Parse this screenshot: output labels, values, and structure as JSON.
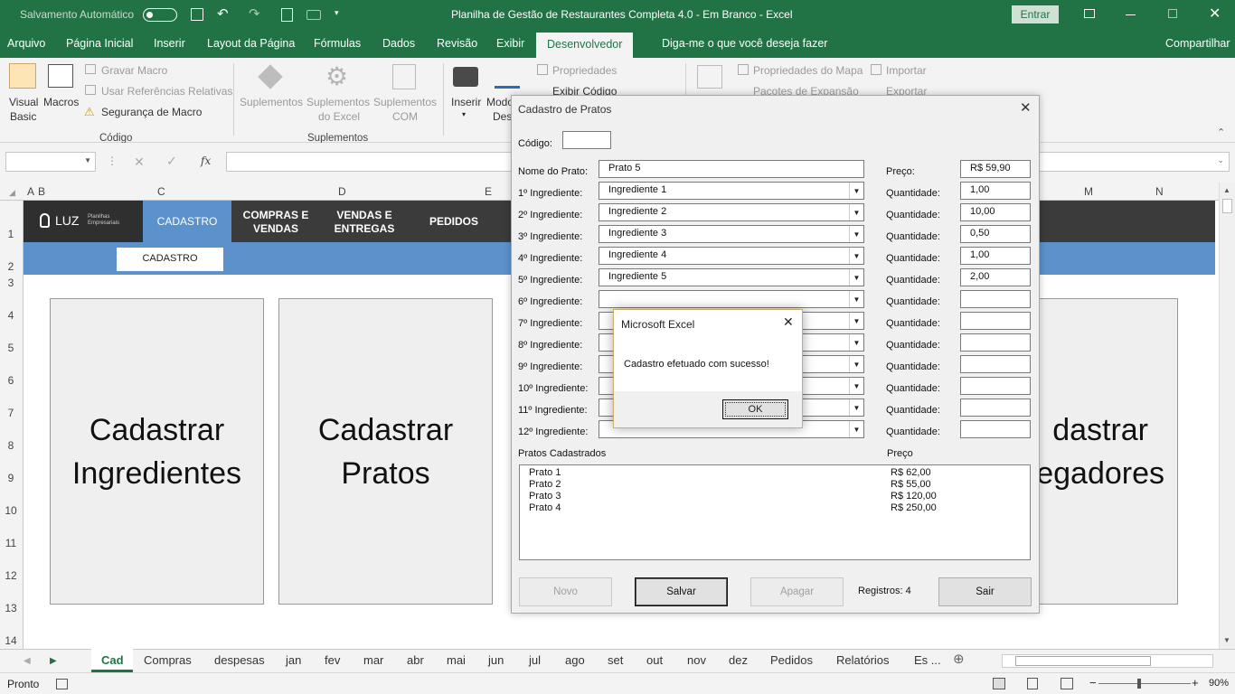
{
  "window": {
    "autosave_label": "Salvamento Automático",
    "title": "Planilha de Gestão de Restaurantes Completa 4.0 - Em Branco  -  Excel",
    "signin": "Entrar"
  },
  "ribbon_tabs": [
    "Arquivo",
    "Página Inicial",
    "Inserir",
    "Layout da Página",
    "Fórmulas",
    "Dados",
    "Revisão",
    "Exibir",
    "Desenvolvedor"
  ],
  "tell_me": "Diga-me o que você deseja fazer",
  "share": "Compartilhar",
  "ribbon": {
    "visual_basic": [
      "Visual",
      "Basic"
    ],
    "macros": "Macros",
    "record_macro": "Gravar Macro",
    "relative_refs": "Usar Referências Relativas",
    "macro_security": "Segurança de Macro",
    "group_code": "Código",
    "addins": "Suplementos",
    "excel_addins": [
      "Suplementos",
      "do Excel"
    ],
    "com_addins": [
      "Suplementos",
      "COM"
    ],
    "group_addins": "Suplementos",
    "insert": "Inserir",
    "design_mode": [
      "Modo",
      "Desi"
    ],
    "properties": "Propriedades",
    "view_code": "Exibir Código",
    "map_properties": "Propriedades do Mapa",
    "expansion_packs": "Pacotes de Expansão",
    "import": "Importar",
    "export": "Exportar"
  },
  "formula": {
    "fx": "fx",
    "name_box": ""
  },
  "columns": [
    "A",
    "B",
    "C",
    "D",
    "E",
    "M",
    "N"
  ],
  "rows": [
    "1",
    "2",
    "3",
    "4",
    "5",
    "6",
    "7",
    "8",
    "9",
    "10",
    "11",
    "12",
    "13",
    "14"
  ],
  "sheet": {
    "logo": "LUZ",
    "logo_sub": [
      "Planilhas",
      "Empresariais"
    ],
    "nav": [
      "CADASTRO",
      "COMPRAS E VENDAS",
      "VENDAS E ENTREGAS",
      "PEDIDOS"
    ],
    "sub_tab": "CADASTRO",
    "cards": [
      "Cadastrar Ingredientes",
      "Cadastrar Pratos",
      "dastrar egadores"
    ]
  },
  "form": {
    "title": "Cadastro de Pratos",
    "code_label": "Código:",
    "code_value": "",
    "name_label": "Nome do Prato:",
    "name_value": "Prato 5",
    "price_label": "Preço:",
    "price_value": "R$ 59,90",
    "qty_label": "Quantidade:",
    "ingredients": [
      {
        "label": "1º Ingrediente:",
        "value": "Ingrediente 1",
        "qty": "1,00"
      },
      {
        "label": "2º Ingrediente:",
        "value": "Ingrediente 2",
        "qty": "10,00"
      },
      {
        "label": "3º Ingrediente:",
        "value": "Ingrediente 3",
        "qty": "0,50"
      },
      {
        "label": "4º Ingrediente:",
        "value": "Ingrediente 4",
        "qty": "1,00"
      },
      {
        "label": "5º Ingrediente:",
        "value": "Ingrediente 5",
        "qty": "2,00"
      },
      {
        "label": "6º Ingrediente:",
        "value": "",
        "qty": ""
      },
      {
        "label": "7º Ingrediente:",
        "value": "",
        "qty": ""
      },
      {
        "label": "8º Ingrediente:",
        "value": "",
        "qty": ""
      },
      {
        "label": "9º Ingrediente:",
        "value": "",
        "qty": ""
      },
      {
        "label": "10º Ingrediente:",
        "value": "",
        "qty": ""
      },
      {
        "label": "11º Ingrediente:",
        "value": "",
        "qty": ""
      },
      {
        "label": "12º Ingrediente:",
        "value": "",
        "qty": ""
      }
    ],
    "list_header": "Pratos Cadastrados",
    "list_price_header": "Preço",
    "dishes": [
      {
        "name": "Prato 1",
        "price": "R$ 62,00"
      },
      {
        "name": "Prato 2",
        "price": "R$ 55,00"
      },
      {
        "name": "Prato 3",
        "price": "R$ 120,00"
      },
      {
        "name": "Prato 4",
        "price": "R$ 250,00"
      }
    ],
    "buttons": {
      "new": "Novo",
      "save": "Salvar",
      "delete": "Apagar",
      "exit": "Sair"
    },
    "records": "Registros: 4"
  },
  "msgbox": {
    "title": "Microsoft Excel",
    "message": "Cadastro efetuado com sucesso!",
    "ok": "OK"
  },
  "sheet_tabs": [
    "Cad",
    "Compras",
    "despesas",
    "jan",
    "fev",
    "mar",
    "abr",
    "mai",
    "jun",
    "jul",
    "ago",
    "set",
    "out",
    "nov",
    "dez",
    "Pedidos",
    "Relatórios",
    "Es ..."
  ],
  "status": {
    "ready": "Pronto",
    "zoom": "90%"
  },
  "colors": {
    "excel_green": "#217346",
    "nav_dark": "#3b3b3b",
    "nav_blue": "#5b92cc",
    "nav_active": "#5b92cc"
  }
}
